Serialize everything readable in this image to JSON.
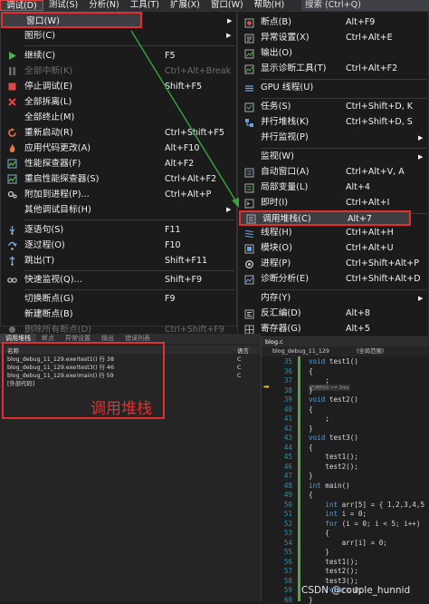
{
  "menubar": {
    "items": [
      "调试(D)",
      "测试(S)",
      "分析(N)",
      "工具(T)",
      "扩展(X)",
      "窗口(W)",
      "帮助(H)"
    ],
    "search": "搜索 (Ctrl+Q)"
  },
  "debug_menu": {
    "window": {
      "label": "窗口(W)"
    },
    "graphics": {
      "label": "图形(C)"
    },
    "continue": {
      "label": "继续(C)",
      "shortcut": "F5"
    },
    "break_all": {
      "label": "全部中断(K)",
      "shortcut": "Ctrl+Alt+Break"
    },
    "stop": {
      "label": "停止调试(E)",
      "shortcut": "Shift+F5"
    },
    "detach_all": {
      "label": "全部拆离(L)"
    },
    "terminate_all": {
      "label": "全部终止(M)"
    },
    "restart": {
      "label": "重新启动(R)",
      "shortcut": "Ctrl+Shift+F5"
    },
    "apply_changes": {
      "label": "应用代码更改(A)",
      "shortcut": "Alt+F10"
    },
    "profiler": {
      "label": "性能探查器(F)",
      "shortcut": "Alt+F2"
    },
    "relaunch_profiler": {
      "label": "重启性能探查器(S)",
      "shortcut": "Ctrl+Alt+F2"
    },
    "attach": {
      "label": "附加到进程(P)...",
      "shortcut": "Ctrl+Alt+P"
    },
    "other_targets": {
      "label": "其他调试目标(H)"
    },
    "step_into": {
      "label": "逐语句(S)",
      "shortcut": "F11"
    },
    "step_over": {
      "label": "逐过程(O)",
      "shortcut": "F10"
    },
    "step_out": {
      "label": "跳出(T)",
      "shortcut": "Shift+F11"
    },
    "quickwatch": {
      "label": "快速监视(Q)...",
      "shortcut": "Shift+F9"
    },
    "toggle_bp": {
      "label": "切换断点(G)",
      "shortcut": "F9"
    },
    "new_bp": {
      "label": "新建断点(B)"
    },
    "delete_bps": {
      "label": "删除所有断点(D)",
      "shortcut": "Ctrl+Shift+F9"
    }
  },
  "window_submenu": {
    "breakpoints": {
      "label": "断点(B)",
      "shortcut": "Alt+F9"
    },
    "exception": {
      "label": "异常设置(X)",
      "shortcut": "Ctrl+Alt+E"
    },
    "output": {
      "label": "输出(O)"
    },
    "diag_tools": {
      "label": "显示诊断工具(T)",
      "shortcut": "Ctrl+Alt+F2"
    },
    "gpu_threads": {
      "label": "GPU 线程(U)"
    },
    "tasks": {
      "label": "任务(S)",
      "shortcut": "Ctrl+Shift+D, K"
    },
    "parallel_stacks": {
      "label": "并行堆栈(K)",
      "shortcut": "Ctrl+Shift+D, S"
    },
    "parallel_watch": {
      "label": "并行监视(P)"
    },
    "watch": {
      "label": "监视(W)"
    },
    "autos": {
      "label": "自动窗口(A)",
      "shortcut": "Ctrl+Alt+V, A"
    },
    "locals": {
      "label": "局部变量(L)",
      "shortcut": "Alt+4"
    },
    "immediate": {
      "label": "即时(I)",
      "shortcut": "Ctrl+Alt+I"
    },
    "call_stack": {
      "label": "调用堆栈(C)",
      "shortcut": "Alt+7"
    },
    "threads": {
      "label": "线程(H)",
      "shortcut": "Ctrl+Alt+H"
    },
    "modules": {
      "label": "模块(O)",
      "shortcut": "Ctrl+Alt+U"
    },
    "processes": {
      "label": "进程(P)",
      "shortcut": "Ctrl+Shift+Alt+P"
    },
    "diag_analysis": {
      "label": "诊断分析(E)",
      "shortcut": "Ctrl+Shift+Alt+D"
    },
    "memory": {
      "label": "内存(Y)"
    },
    "disassembly": {
      "label": "反汇编(D)",
      "shortcut": "Alt+8"
    },
    "registers": {
      "label": "寄存器(G)",
      "shortcut": "Alt+5"
    }
  },
  "callstack_panel": {
    "tabs": [
      "调用堆栈",
      "断点",
      "异常设置",
      "输出",
      "错误列表"
    ],
    "col_name": "名称",
    "col_lang": "语言",
    "rows": [
      {
        "name": "blog_debug_11_129.exe!test1() 行 38",
        "lang": "C"
      },
      {
        "name": "blog_debug_11_129.exe!test3() 行 46",
        "lang": "C"
      },
      {
        "name": "blog_debug_11_129.exe!main() 行 59",
        "lang": "C"
      },
      {
        "name": "[外部代码]",
        "lang": ""
      }
    ],
    "annotation": "调用堆栈"
  },
  "editor": {
    "file_tab": "blog.c",
    "project": "blog_debug_11_129",
    "scope": "(全局范围)",
    "hint": "已用时间 <= 3ms",
    "lines": [
      {
        "n": "35",
        "code": "void test1()"
      },
      {
        "n": "36",
        "code": "{"
      },
      {
        "n": "37",
        "code": "    ;"
      },
      {
        "n": "38",
        "code": "}"
      },
      {
        "n": "39",
        "code": "void test2()"
      },
      {
        "n": "40",
        "code": "{"
      },
      {
        "n": "41",
        "code": "    ;"
      },
      {
        "n": "42",
        "code": "}"
      },
      {
        "n": "43",
        "code": "void test3()"
      },
      {
        "n": "44",
        "code": "{"
      },
      {
        "n": "45",
        "code": "    test1();"
      },
      {
        "n": "46",
        "code": "    test2();"
      },
      {
        "n": "47",
        "code": "}"
      },
      {
        "n": "48",
        "code": "int main()"
      },
      {
        "n": "49",
        "code": "{"
      },
      {
        "n": "50",
        "code": "    int arr[5] = { 1,2,3,4,5 };"
      },
      {
        "n": "51",
        "code": "    int i = 0;"
      },
      {
        "n": "52",
        "code": "    for (i = 0; i < 5; i++)"
      },
      {
        "n": "53",
        "code": "    {"
      },
      {
        "n": "54",
        "code": "        arr[i] = 0;"
      },
      {
        "n": "55",
        "code": "    }"
      },
      {
        "n": "56",
        "code": "    test1();"
      },
      {
        "n": "57",
        "code": "    test2();"
      },
      {
        "n": "58",
        "code": "    test3();"
      },
      {
        "n": "59",
        "code": "    return 0;"
      },
      {
        "n": "60",
        "code": "}"
      }
    ]
  },
  "watermark": "CSDN @couple_hunnid",
  "colors": {
    "highlight_box": "#e03030",
    "arrow": "#3aa33a",
    "line_numbers": "#2b91af",
    "keyword": "#569cd6"
  }
}
